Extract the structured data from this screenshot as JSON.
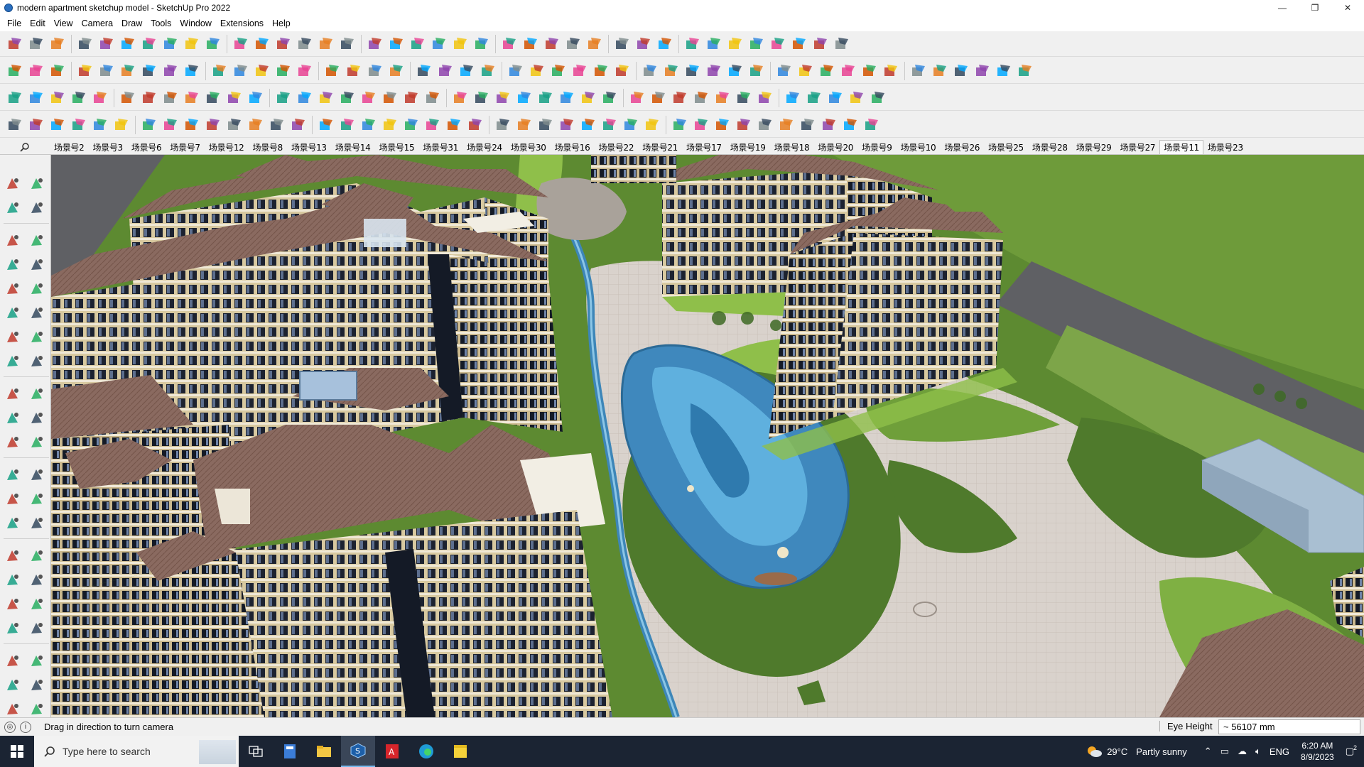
{
  "window": {
    "title": "modern apartment sketchup model - SketchUp Pro 2022",
    "minimize": "—",
    "maximize": "❐",
    "close": "✕"
  },
  "menu": [
    "File",
    "Edit",
    "View",
    "Camera",
    "Draw",
    "Tools",
    "Window",
    "Extensions",
    "Help"
  ],
  "scenes": {
    "search_icon": "search-icon",
    "tabs": [
      "场景号2",
      "场景号3",
      "场景号6",
      "场景号7",
      "场景号12",
      "场景号8",
      "场景号13",
      "场景号14",
      "场景号15",
      "场景号31",
      "场景号24",
      "场景号30",
      "场景号16",
      "场景号22",
      "场景号21",
      "场景号17",
      "场景号19",
      "场景号18",
      "场景号20",
      "场景号9",
      "场景号10",
      "场景号26",
      "场景号25",
      "场景号28",
      "场景号29",
      "场景号27",
      "场景号11",
      "场景号23"
    ],
    "active": "场景号11"
  },
  "status": {
    "message": "Drag in direction to turn camera",
    "eye_height_label": "Eye Height",
    "eye_height_value": "~ 56107 mm"
  },
  "taskbar": {
    "search_placeholder": "Type here to search",
    "weather_temp": "29°C",
    "weather_desc": "Partly sunny",
    "language": "ENG",
    "time": "6:20 AM",
    "date": "8/9/2023",
    "notification_count": "2"
  },
  "colors": {
    "grass_dark": "#4f7a2c",
    "grass_light": "#8fbf4a",
    "path": "#d9d2cc",
    "water": "#4a9ccf",
    "roof": "#7d5a50",
    "facade": "#d8c9a0",
    "taskbar": "#1b2433"
  }
}
